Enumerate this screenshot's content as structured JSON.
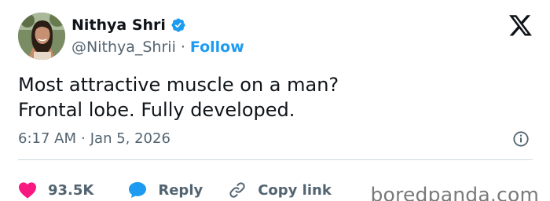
{
  "user": {
    "display_name": "Nithya Shri",
    "handle": "@Nithya_Shrii",
    "separator": "·",
    "follow_label": "Follow"
  },
  "tweet": {
    "lines": [
      "Most attractive muscle on a man?",
      "Frontal lobe. Fully developed."
    ],
    "time": "6:17 AM",
    "separator": "·",
    "date": "Jan 5, 2026"
  },
  "actions": {
    "likes": "93.5K",
    "reply_label": "Reply",
    "copy_link_label": "Copy link"
  },
  "watermark": "boredpanda.com",
  "icons": {
    "verified": "verified-badge-icon",
    "platform": "x-logo-icon",
    "info": "info-icon",
    "like": "heart-icon",
    "reply": "speech-bubble-icon",
    "link": "link-icon"
  },
  "colors": {
    "accent": "#1d9bf0",
    "text_primary": "#0f1419",
    "text_secondary": "#536471",
    "heart": "#f91880",
    "divider": "#cfd9de"
  }
}
